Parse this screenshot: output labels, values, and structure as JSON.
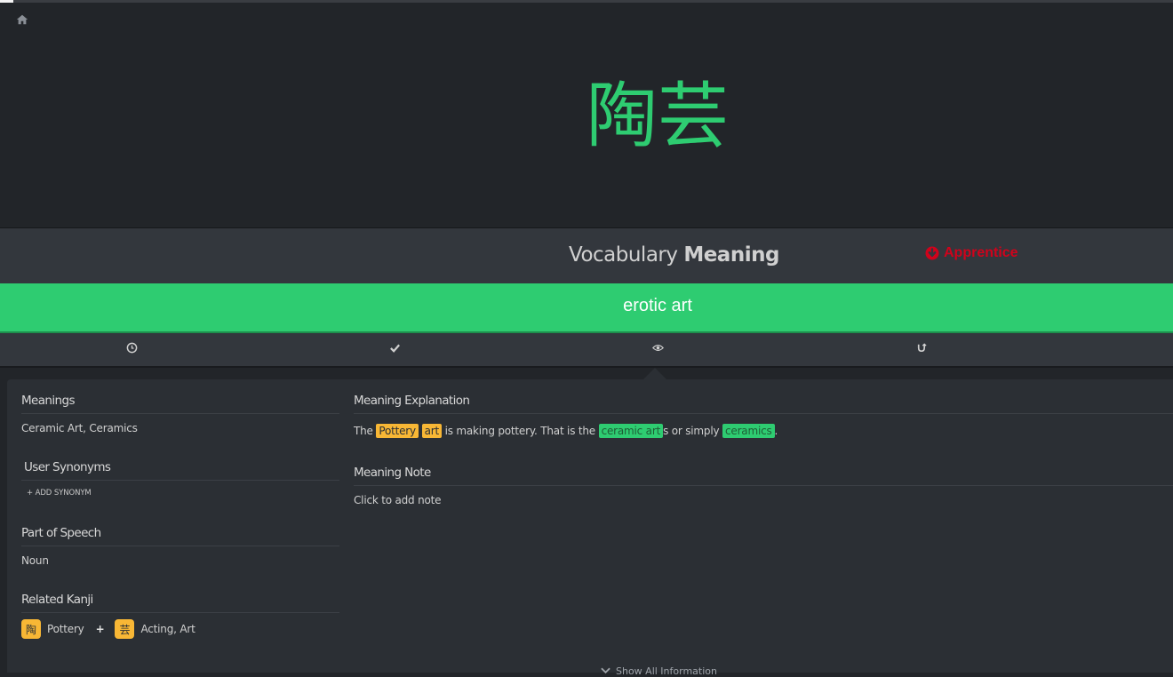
{
  "progress": {
    "fraction": 0.011
  },
  "header": {
    "home_icon": "home-icon"
  },
  "item": {
    "characters": "陶芸"
  },
  "question": {
    "category": "Vocabulary",
    "type": "Meaning",
    "srs_level": "Apprentice",
    "srs_icon": "arrow-circle-down-icon",
    "srs_color": "#d0021b"
  },
  "answer": {
    "value": "erotic art",
    "state_color": "#2ecc71"
  },
  "actions": [
    {
      "name": "last-items-button",
      "icon": "clock-icon"
    },
    {
      "name": "submit-button",
      "icon": "check-icon"
    },
    {
      "name": "item-info-button",
      "icon": "eye-icon"
    },
    {
      "name": "retry-button",
      "icon": "undo-icon"
    }
  ],
  "info": {
    "meanings_title": "Meanings",
    "meanings_value": "Ceramic Art, Ceramics",
    "user_synonyms_title": "User Synonyms",
    "add_synonym_label": "+ ADD SYNONYM",
    "part_of_speech_title": "Part of Speech",
    "part_of_speech_value": "Noun",
    "related_kanji_title": "Related Kanji",
    "related_kanji": [
      {
        "character": "陶",
        "meaning": "Pottery"
      },
      {
        "character": "芸",
        "meaning": "Acting, Art"
      }
    ],
    "related_kanji_separator": "+",
    "explanation_title": "Meaning Explanation",
    "explanation": {
      "p1": "The ",
      "h1": "Pottery",
      "p2": " ",
      "h2": "art",
      "p3": " is making pottery. That is the ",
      "h3": "ceramic art",
      "p4": "s or simply ",
      "h4": "ceramics",
      "p5": "."
    },
    "note_title": "Meaning Note",
    "note_placeholder": "Click to add note",
    "show_all_label": "Show All Information"
  },
  "colors": {
    "radical": "#f8b735",
    "vocabulary": "#2ecc71",
    "background": "#222529"
  }
}
